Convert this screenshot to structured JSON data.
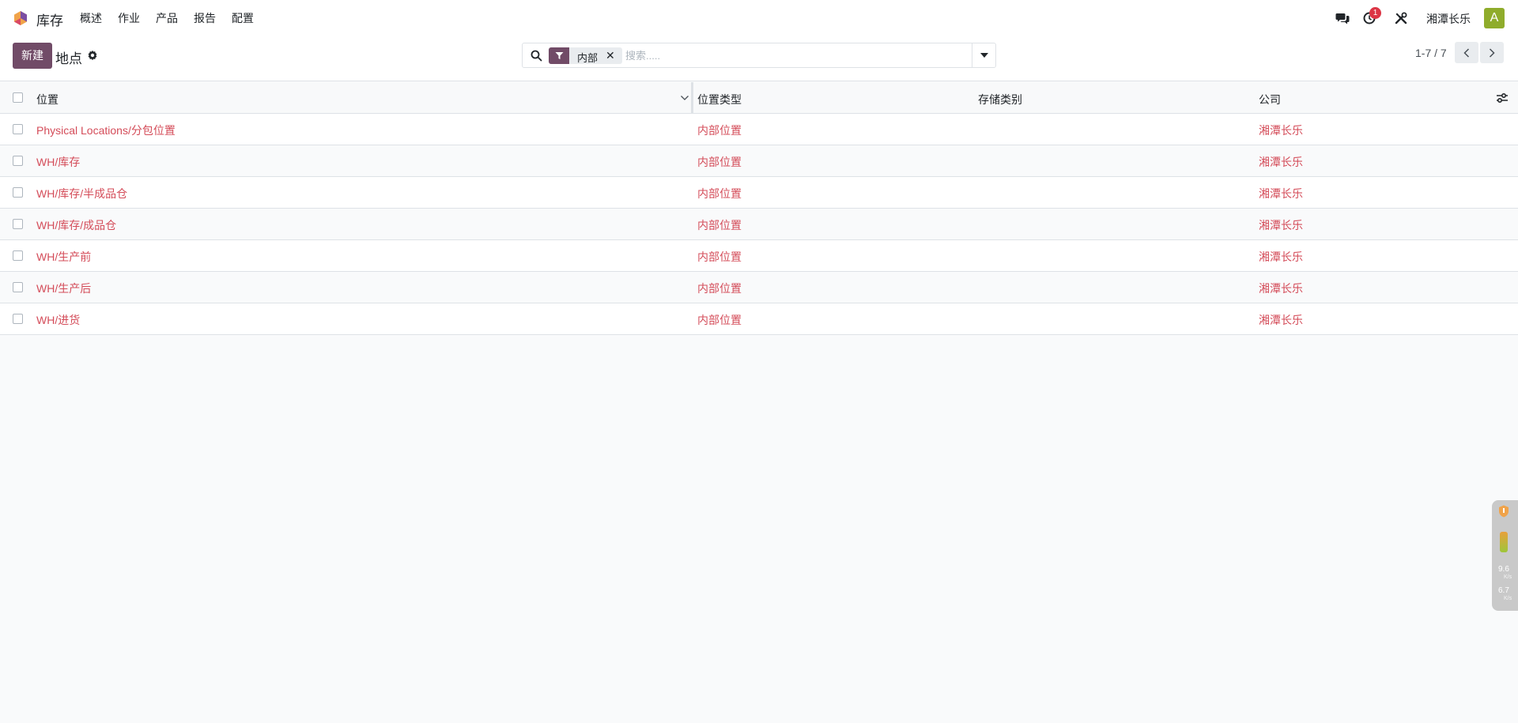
{
  "navbar": {
    "app_name": "库存",
    "menu": [
      "概述",
      "作业",
      "产品",
      "报告",
      "配置"
    ],
    "activity_count": "1",
    "company": "湘潭长乐",
    "avatar_letter": "A"
  },
  "control": {
    "new_label": "新建",
    "title": "地点",
    "facet_label": "内部",
    "facet_remove": "✕",
    "search_placeholder": "搜索.....",
    "pager": "1-7 / 7"
  },
  "table": {
    "headers": [
      "位置",
      "位置类型",
      "存储类别",
      "公司"
    ],
    "rows": [
      {
        "location": "Physical Locations/分包位置",
        "type": "内部位置",
        "storage": "",
        "company": "湘潭长乐"
      },
      {
        "location": "WH/库存",
        "type": "内部位置",
        "storage": "",
        "company": "湘潭长乐"
      },
      {
        "location": "WH/库存/半成品仓",
        "type": "内部位置",
        "storage": "",
        "company": "湘潭长乐"
      },
      {
        "location": "WH/库存/成品仓",
        "type": "内部位置",
        "storage": "",
        "company": "湘潭长乐"
      },
      {
        "location": "WH/生产前",
        "type": "内部位置",
        "storage": "",
        "company": "湘潭长乐"
      },
      {
        "location": "WH/生产后",
        "type": "内部位置",
        "storage": "",
        "company": "湘潭长乐"
      },
      {
        "location": "WH/进货",
        "type": "内部位置",
        "storage": "",
        "company": "湘潭长乐"
      }
    ]
  },
  "netmon": {
    "up_value": "9.6",
    "up_unit": "K/s",
    "down_value": "6.7",
    "down_unit": "K/s"
  },
  "colors": {
    "brand": "#714b67",
    "link": "#d44c59",
    "badge": "#dc3545",
    "avatar": "#8fac2b"
  },
  "icons": [
    "app-logo-icon",
    "chat-icon",
    "activity-clock-icon",
    "tools-icon",
    "gear-icon",
    "search-icon",
    "filter-icon",
    "caret-down-icon",
    "chevron-left-icon",
    "chevron-right-icon",
    "sort-chevron-icon",
    "optional-columns-icon",
    "shield-icon"
  ]
}
